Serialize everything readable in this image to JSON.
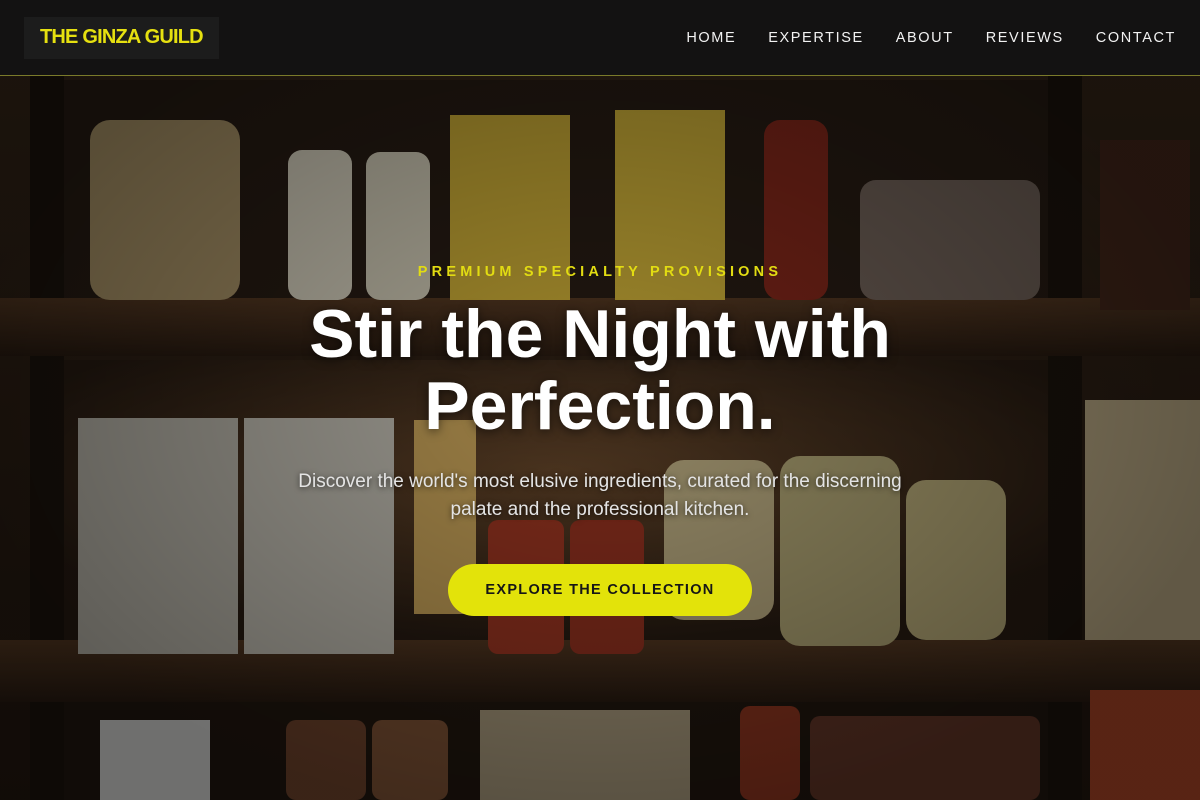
{
  "brand": {
    "name": "THE GINZA GUILD"
  },
  "nav": {
    "items": [
      {
        "label": "HOME"
      },
      {
        "label": "EXPERTISE"
      },
      {
        "label": "ABOUT"
      },
      {
        "label": "REVIEWS"
      },
      {
        "label": "CONTACT"
      }
    ]
  },
  "hero": {
    "eyebrow": "PREMIUM SPECIALTY PROVISIONS",
    "headline_line1": "Stir the Night with",
    "headline_line2": "Perfection.",
    "subtitle": "Discover the world's most elusive ingredients, curated for the discerning palate and the professional kitchen.",
    "cta_label": "EXPLORE THE COLLECTION",
    "background_image": "pantry-shelves-photo"
  },
  "colors": {
    "accent": "#e3e30a",
    "header_bg": "#121212",
    "text_light": "#ffffff"
  }
}
